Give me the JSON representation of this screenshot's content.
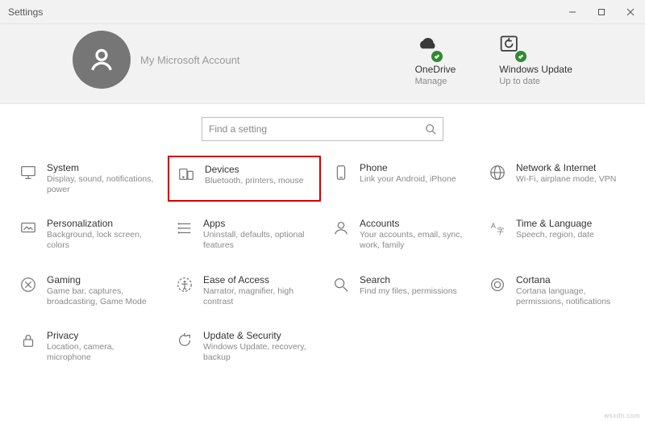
{
  "window": {
    "title": "Settings"
  },
  "account": {
    "name": "My Microsoft Account"
  },
  "statuses": {
    "onedrive": {
      "title": "OneDrive",
      "sub": "Manage"
    },
    "update": {
      "title": "Windows Update",
      "sub": "Up to date"
    }
  },
  "search": {
    "placeholder": "Find a setting"
  },
  "tiles": {
    "system": {
      "title": "System",
      "desc": "Display, sound, notifications, power"
    },
    "devices": {
      "title": "Devices",
      "desc": "Bluetooth, printers, mouse"
    },
    "phone": {
      "title": "Phone",
      "desc": "Link your Android, iPhone"
    },
    "network": {
      "title": "Network & Internet",
      "desc": "Wi-Fi, airplane mode, VPN"
    },
    "personalization": {
      "title": "Personalization",
      "desc": "Background, lock screen, colors"
    },
    "apps": {
      "title": "Apps",
      "desc": "Uninstall, defaults, optional features"
    },
    "accounts": {
      "title": "Accounts",
      "desc": "Your accounts, email, sync, work, family"
    },
    "time": {
      "title": "Time & Language",
      "desc": "Speech, region, date"
    },
    "gaming": {
      "title": "Gaming",
      "desc": "Game bar, captures, broadcasting, Game Mode"
    },
    "ease": {
      "title": "Ease of Access",
      "desc": "Narrator, magnifier, high contrast"
    },
    "search_tile": {
      "title": "Search",
      "desc": "Find my files, permissions"
    },
    "cortana": {
      "title": "Cortana",
      "desc": "Cortana language, permissions, notifications"
    },
    "privacy": {
      "title": "Privacy",
      "desc": "Location, camera, microphone"
    },
    "update_sec": {
      "title": "Update & Security",
      "desc": "Windows Update, recovery, backup"
    }
  },
  "watermark": "wsxdn.com",
  "highlighted_tile": "devices"
}
